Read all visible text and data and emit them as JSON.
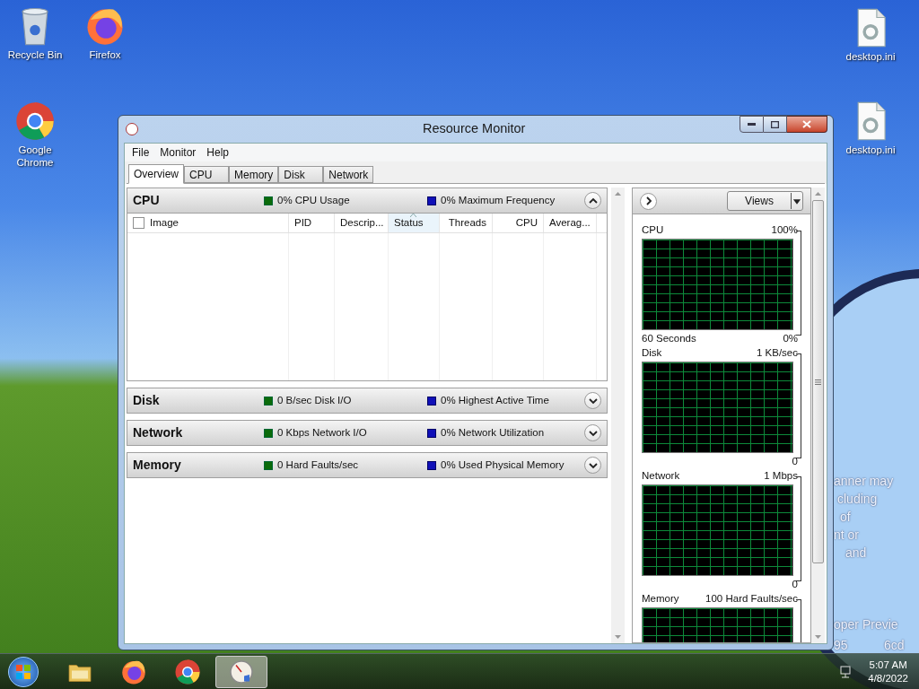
{
  "desktop": {
    "icons": [
      {
        "label": "Recycle Bin",
        "kind": "recycle"
      },
      {
        "label": "Firefox",
        "kind": "firefox"
      },
      {
        "label": "desktop.ini",
        "kind": "file"
      },
      {
        "label": "Google Chrome",
        "kind": "chrome"
      },
      {
        "label": "desktop.ini",
        "kind": "file"
      }
    ],
    "notice_fragments": [
      "anner may",
      "cluding",
      "of",
      "nt or",
      "and",
      "oper Previe",
      "95",
      "6cd"
    ]
  },
  "window": {
    "title": "Resource Monitor",
    "menu": [
      "File",
      "Monitor",
      "Help"
    ],
    "tabs": [
      {
        "label": "Overview",
        "selected": true
      },
      {
        "label": "CPU",
        "selected": false
      },
      {
        "label": "Memory",
        "selected": false
      },
      {
        "label": "Disk",
        "selected": false
      },
      {
        "label": "Network",
        "selected": false
      }
    ],
    "sections": [
      {
        "title": "CPU",
        "metric_1": "0% CPU Usage",
        "metric_2": "0% Maximum Frequency",
        "expanded": true,
        "table": {
          "select_all_checked": false,
          "columns": [
            {
              "label": "Image",
              "sorted": false
            },
            {
              "label": "PID",
              "sorted": false
            },
            {
              "label": "Descrip...",
              "sorted": false
            },
            {
              "label": "Status",
              "sorted": true
            },
            {
              "label": "Threads",
              "sorted": false
            },
            {
              "label": "CPU",
              "sorted": false
            },
            {
              "label": "Averag...",
              "sorted": false
            }
          ]
        }
      },
      {
        "title": "Disk",
        "metric_1": "0 B/sec Disk I/O",
        "metric_2": "0% Highest Active Time",
        "expanded": false
      },
      {
        "title": "Network",
        "metric_1": "0 Kbps Network I/O",
        "metric_2": "0% Network Utilization",
        "expanded": false
      },
      {
        "title": "Memory",
        "metric_1": "0 Hard Faults/sec",
        "metric_2": "0% Used Physical Memory",
        "expanded": false
      }
    ],
    "graph_panel": {
      "views_button": "Views",
      "graphs": [
        {
          "title": "CPU",
          "scale_max": "100%",
          "time_label": "60 Seconds",
          "scale_min": "0%"
        },
        {
          "title": "Disk",
          "scale_max": "1 KB/sec",
          "scale_min": "0"
        },
        {
          "title": "Network",
          "scale_max": "1 Mbps",
          "scale_min": "0"
        },
        {
          "title": "Memory",
          "scale_max": "100 Hard Faults/sec"
        }
      ]
    }
  },
  "taskbar": {
    "apps": [
      {
        "kind": "explorer",
        "active": false
      },
      {
        "kind": "firefox",
        "active": false
      },
      {
        "kind": "chrome",
        "active": false
      },
      {
        "kind": "monitor",
        "active": true
      }
    ],
    "clock": {
      "time": "5:07 AM",
      "date": "4/8/2022"
    }
  }
}
